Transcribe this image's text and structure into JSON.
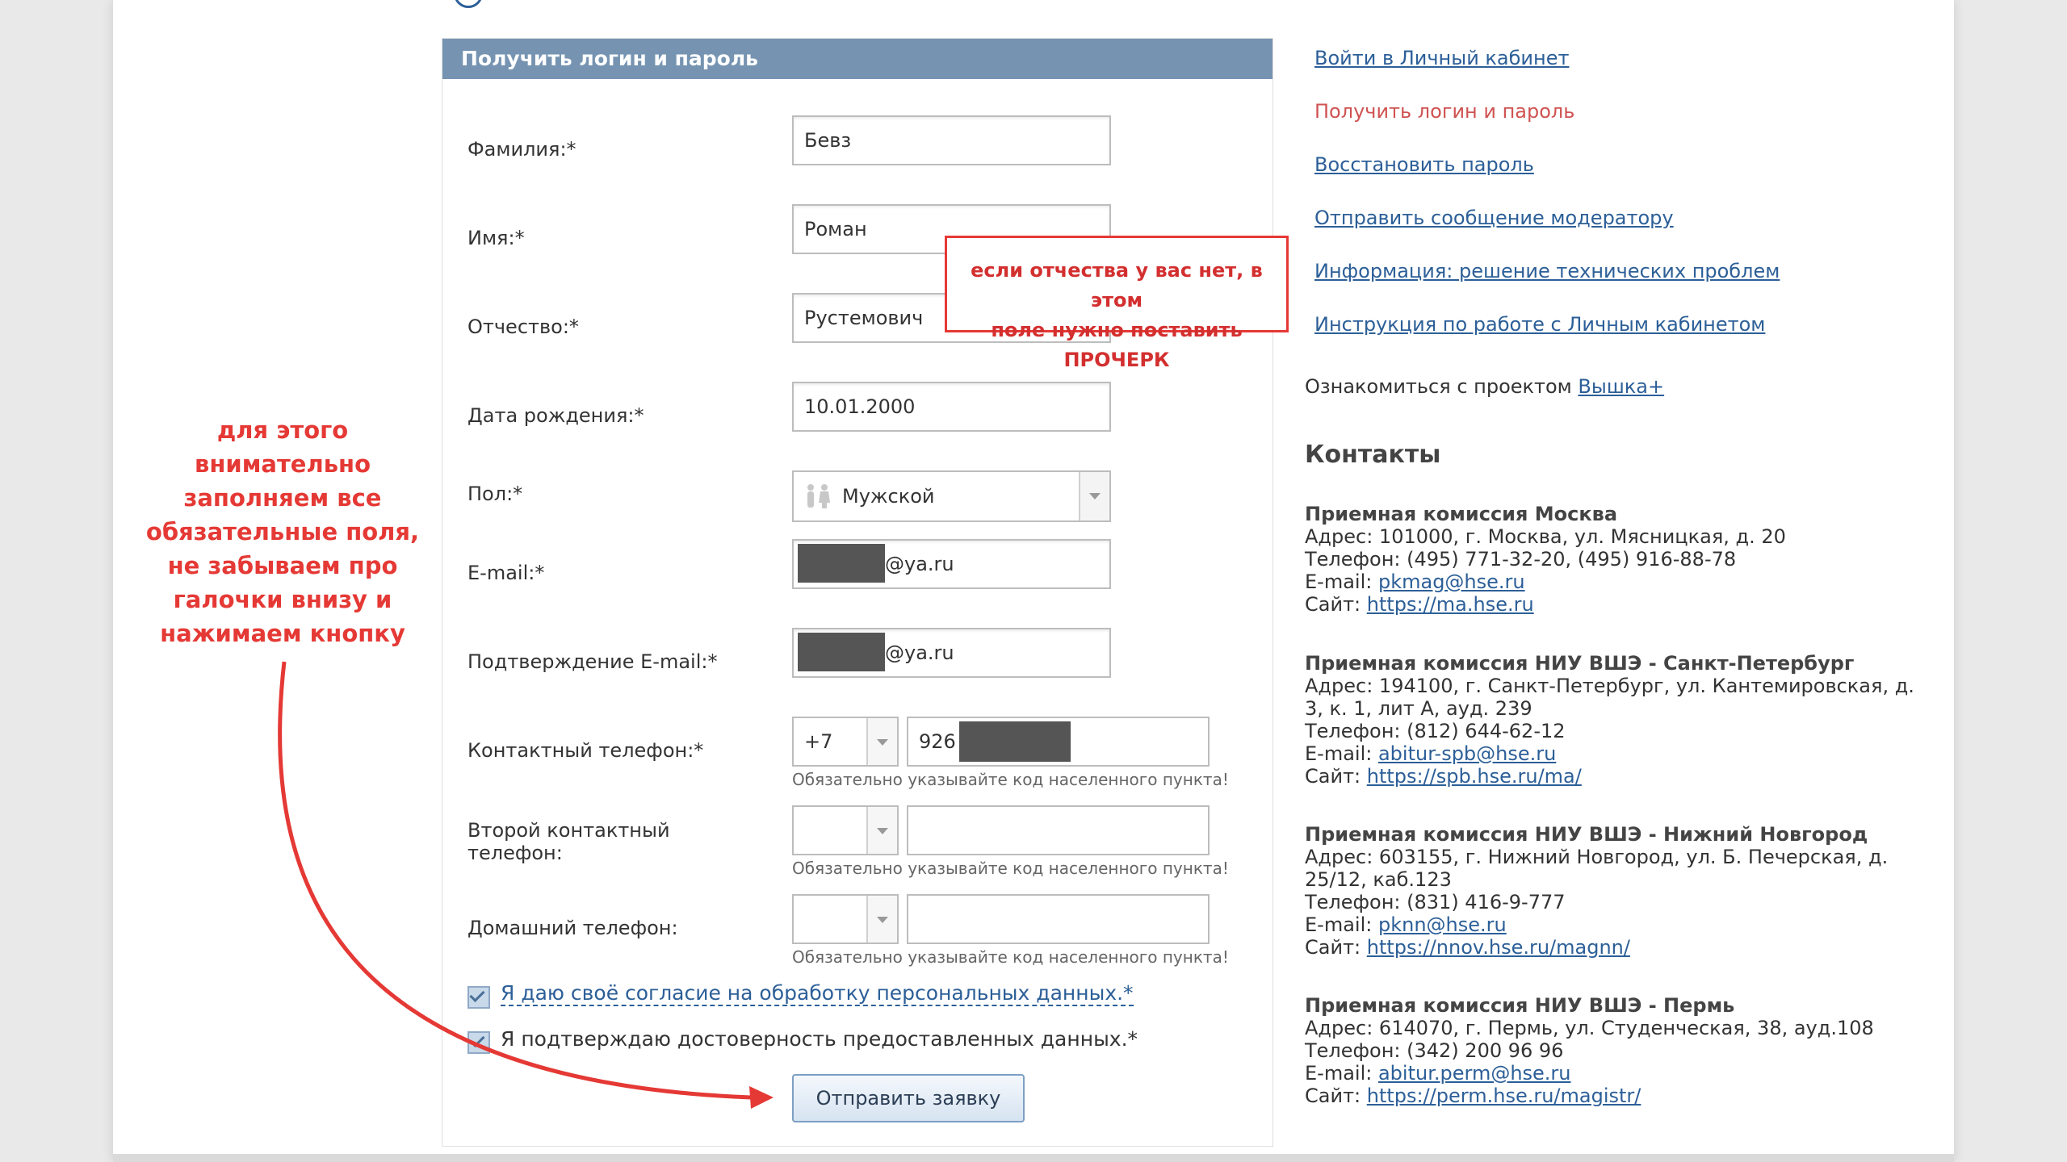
{
  "form": {
    "title": "Получить логин и пароль",
    "labels": {
      "surname": "Фамилия:*",
      "name": "Имя:*",
      "patronymic": "Отчество:*",
      "birthdate": "Дата рождения:*",
      "gender": "Пол:*",
      "email": "E-mail:*",
      "email_confirm": "Подтверждение E-mail:*",
      "phone": "Контактный телефон:*",
      "phone2_line1": "Второй контактный",
      "phone2_line2": "телефон:",
      "home_phone": "Домашний телефон:"
    },
    "values": {
      "surname": "Бевз",
      "name": "Роман",
      "patronymic": "Рустемович",
      "birthdate": "10.01.2000",
      "gender": "Мужской",
      "email_suffix": "@ya.ru",
      "email_confirm_suffix": "@ya.ru",
      "phone_code": "+7",
      "phone_number": "926"
    },
    "hint": "Обязательно указывайте код населенного пункта!",
    "consent": "Я даю своё согласие на обработку персональных данных.*",
    "confirm": "Я подтверждаю достоверность предоставленных данных.*",
    "submit": "Отправить заявку"
  },
  "annotations": {
    "callout_line1": "если отчества у вас нет, в этом",
    "callout_line2": "поле нужно поставить ПРОЧЕРК",
    "left_note": [
      "для этого",
      "внимательно",
      "заполняем все",
      "обязательные поля,",
      "не забываем про",
      "галочки внизу и",
      "нажимаем кнопку"
    ],
    "color": "#e53935"
  },
  "sidebar": {
    "links": [
      "Войти в Личный кабинет",
      "Получить логин и пароль",
      "Восстановить пароль",
      "Отправить сообщение модератору",
      "Информация: решение технических проблем",
      "Инструкция по работе с Личным кабинетом"
    ],
    "project_text": "Ознакомиться с проектом ",
    "project_link": "Вышка+",
    "contacts_title": "Контакты",
    "contacts": [
      {
        "title": "Приемная комиссия Москва",
        "address": "Адрес: 101000, г. Москва, ул. Мясницкая, д. 20",
        "phone": "Телефон: (495) 771-32-20, (495) 916-88-78",
        "email_label": "E-mail: ",
        "email": "pkmag@hse.ru",
        "site_label": "Сайт: ",
        "site": "https://ma.hse.ru"
      },
      {
        "title": "Приемная комиссия НИУ ВШЭ - Санкт-Петербург",
        "address_line1": "Адрес: 194100, г. Санкт-Петербург, ул. Кантемировская, д.",
        "address_line2": "3, к. 1, лит А, ауд. 239",
        "phone": "Телефон: (812) 644-62-12",
        "email_label": "E-mail: ",
        "email": "abitur-spb@hse.ru",
        "site_label": "Сайт: ",
        "site": "https://spb.hse.ru/ma/"
      },
      {
        "title": "Приемная комиссия НИУ ВШЭ - Нижний Новгород",
        "address_line1": "Адрес: 603155, г. Нижний Новгород, ул. Б. Печерская, д.",
        "address_line2": "25/12, каб.123",
        "phone": "Телефон: (831) 416-9-777",
        "email_label": "E-mail: ",
        "email": "pknn@hse.ru",
        "site_label": "Сайт: ",
        "site": "https://nnov.hse.ru/magnn/"
      },
      {
        "title": "Приемная комиссия НИУ ВШЭ - Пермь",
        "address": "Адрес: 614070, г. Пермь, ул. Студенческая, 38, ауд.108",
        "phone": "Телефон: (342) 200 96 96",
        "email_label": "E-mail: ",
        "email": "abitur.perm@hse.ru",
        "site_label": "Сайт: ",
        "site": "https://perm.hse.ru/magistr/"
      }
    ]
  }
}
